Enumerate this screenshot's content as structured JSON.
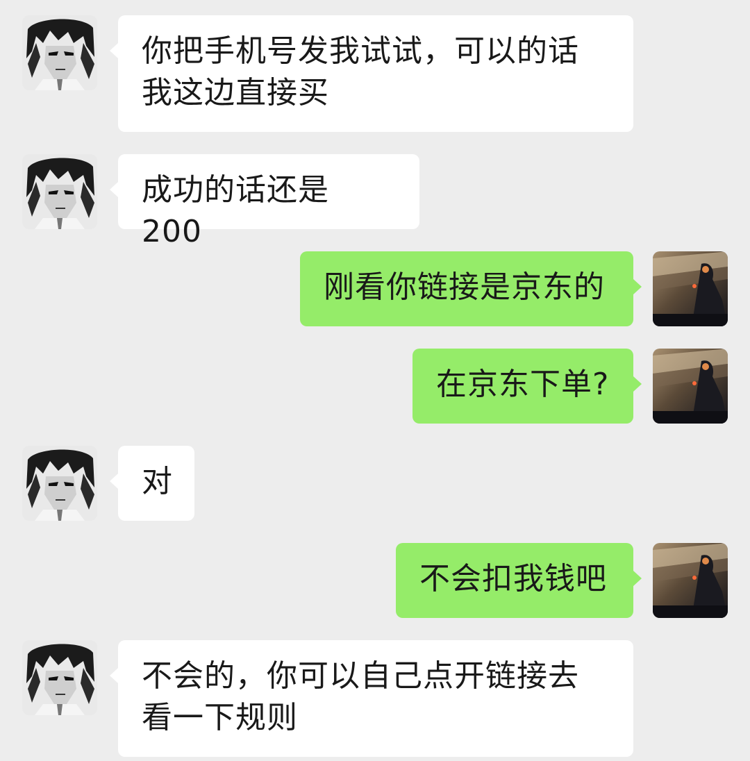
{
  "colors": {
    "background": "#ededed",
    "incoming_bubble": "#ffffff",
    "outgoing_bubble": "#95ec69",
    "text": "#191919"
  },
  "messages": [
    {
      "sender": "contact",
      "avatar": "anime-character-avatar",
      "text": "你把手机号发我试试，可以的话我这边直接买"
    },
    {
      "sender": "contact",
      "avatar": "anime-character-avatar",
      "text": "成功的话还是 200"
    },
    {
      "sender": "self",
      "avatar": "dark-photo-avatar",
      "text": "刚看你链接是京东的"
    },
    {
      "sender": "self",
      "avatar": "dark-photo-avatar",
      "text": "在京东下单?"
    },
    {
      "sender": "contact",
      "avatar": "anime-character-avatar",
      "text": "对"
    },
    {
      "sender": "self",
      "avatar": "dark-photo-avatar",
      "text": "不会扣我钱吧"
    },
    {
      "sender": "contact",
      "avatar": "anime-character-avatar",
      "text": "不会的，你可以自己点开链接去看一下规则"
    }
  ]
}
